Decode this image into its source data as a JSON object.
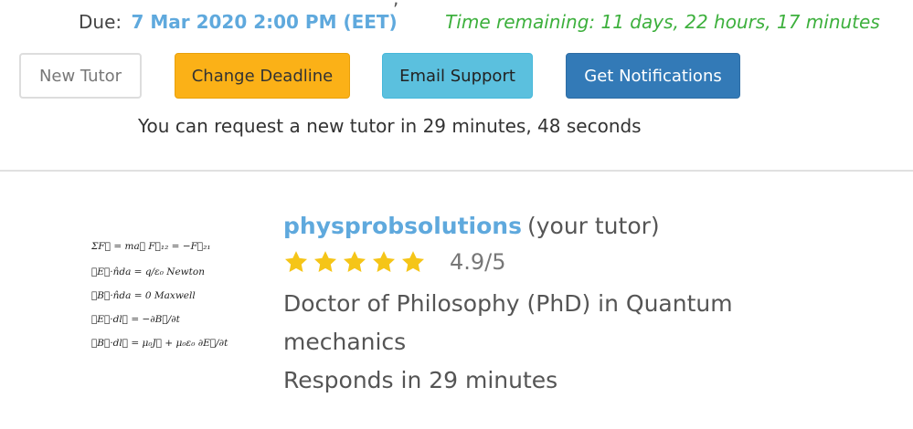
{
  "header": {
    "due_label": "Due:",
    "due_date": "7 Mar 2020 2:00 PM (EET)",
    "time_remaining": "Time remaining: 11 days, 22 hours, 17 minutes"
  },
  "actions": {
    "new_tutor_label": "New Tutor",
    "change_deadline_label": "Change Deadline",
    "email_support_label": "Email Support",
    "get_notifications_label": "Get Notifications"
  },
  "request_notice": "You can request a new tutor in 29 minutes, 48 seconds",
  "tutor": {
    "avatar_lines": [
      "ΣF⃗ = ma⃗    F⃗₁₂ = −F⃗₂₁",
      "∮E⃗·n̂da = q/ε₀    Newton",
      "∮B⃗·n̂da = 0    Maxwell",
      "∮E⃗·dl⃗ = −∂B⃗/∂t",
      "∮B⃗·dl⃗ = μ₀J⃗ + μ₀ε₀ ∂E⃗/∂t"
    ],
    "name": "physprobsolutions",
    "suffix": "(your tutor)",
    "stars": 5,
    "rating": "4.9/5",
    "degree": "Doctor of Philosophy (PhD) in Quantum mechanics",
    "responds": "Responds in 29 minutes"
  },
  "colors": {
    "link_blue": "#5fa9dd",
    "remaining_green": "#3db03d",
    "star_gold": "#f5c518",
    "warning": "#fbb117",
    "info": "#5bc0de",
    "primary": "#337ab7"
  }
}
